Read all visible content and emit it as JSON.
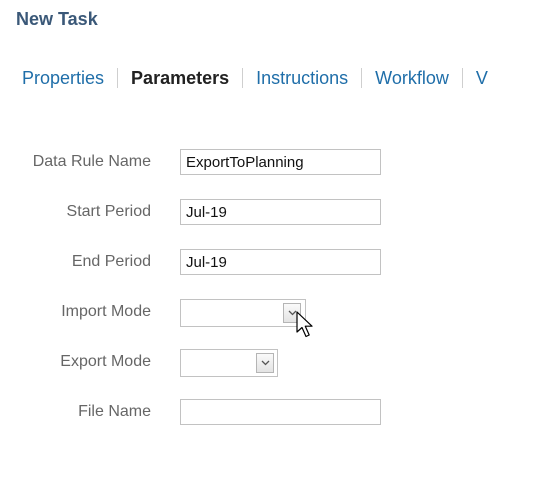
{
  "header": {
    "title": "New Task"
  },
  "tabs": [
    {
      "label": "Properties",
      "active": false
    },
    {
      "label": "Parameters",
      "active": true
    },
    {
      "label": "Instructions",
      "active": false
    },
    {
      "label": "Workflow",
      "active": false
    },
    {
      "label": "V",
      "active": false
    }
  ],
  "form": {
    "data_rule_name": {
      "label": "Data Rule Name",
      "value": "ExportToPlanning"
    },
    "start_period": {
      "label": "Start Period",
      "value": "Jul-19"
    },
    "end_period": {
      "label": "End Period",
      "value": "Jul-19"
    },
    "import_mode": {
      "label": "Import Mode",
      "value": ""
    },
    "export_mode": {
      "label": "Export Mode",
      "value": ""
    },
    "file_name": {
      "label": "File Name",
      "value": ""
    }
  },
  "icons": {
    "dropdown": "chevron-down-icon",
    "cursor": "mouse-pointer-icon"
  },
  "colors": {
    "title": "#3a5878",
    "tab_link": "#1f6ea9",
    "tab_active": "#222222",
    "label": "#666666",
    "field_border": "#c2c2c2"
  }
}
